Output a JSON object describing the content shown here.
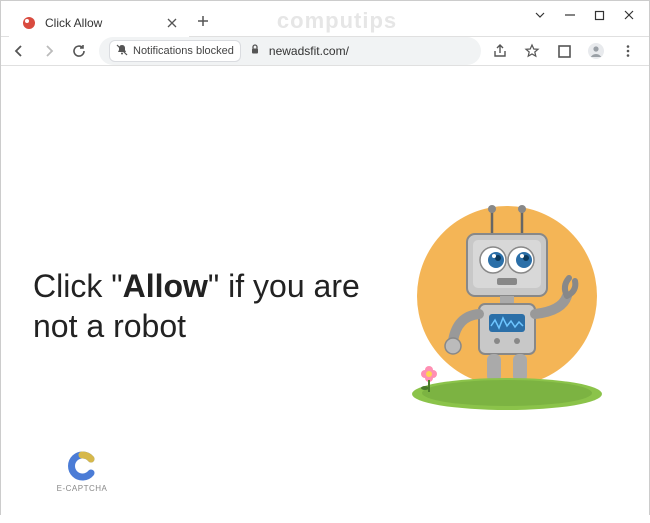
{
  "tab": {
    "title": "Click Allow"
  },
  "toolbar": {
    "notifications_blocked": "Notifications blocked",
    "url": "newadsfit.com/"
  },
  "watermark": "computips",
  "content": {
    "text_1": "Click \"",
    "text_allow": "Allow",
    "text_2": "\" if you are not a robot",
    "captcha_label": "E-CAPTCHA"
  }
}
